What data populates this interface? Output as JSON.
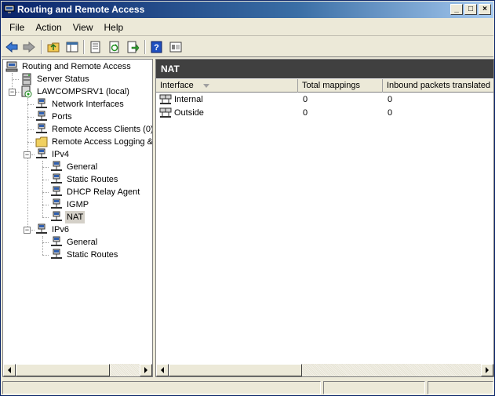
{
  "window": {
    "title": "Routing and Remote Access",
    "minimize": "_",
    "maximize": "□",
    "close": "×"
  },
  "menu": [
    "File",
    "Action",
    "View",
    "Help"
  ],
  "toolbar": [
    "back-icon",
    "forward-icon",
    "up-folder-icon",
    "show-hide-tree-icon",
    "properties-icon",
    "refresh-icon",
    "export-list-icon",
    "help-icon",
    "console-view-icon"
  ],
  "tree": {
    "root": "Routing and Remote Access",
    "server_status": "Server Status",
    "server": "LAWCOMPSRV1 (local)",
    "network_interfaces": "Network Interfaces",
    "ports": "Ports",
    "remote_access_clients": "Remote Access Clients (0)",
    "remote_access_logging": "Remote Access Logging & Policies",
    "ipv4": "IPv4",
    "ipv4_children": [
      "General",
      "Static Routes",
      "DHCP Relay Agent",
      "IGMP",
      "NAT"
    ],
    "ipv6": "IPv6",
    "ipv6_children": [
      "General",
      "Static Routes"
    ],
    "expander_minus": "−"
  },
  "right": {
    "header": "NAT",
    "columns": [
      "Interface",
      "Total mappings",
      "Inbound packets translated"
    ],
    "rows": [
      {
        "interface": "Internal",
        "mappings": "0",
        "inbound": "0"
      },
      {
        "interface": "Outside",
        "mappings": "0",
        "inbound": "0"
      }
    ]
  },
  "colors": {
    "title_start": "#0a246a",
    "pane_header": "#404040",
    "selection": "#d4d0c8"
  }
}
